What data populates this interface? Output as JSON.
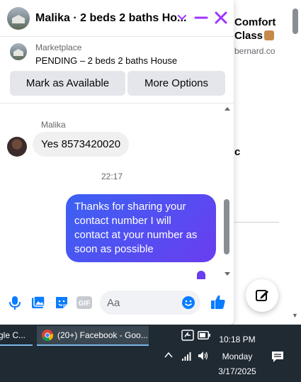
{
  "background_page": {
    "post_title_line1": "Comfort",
    "post_title_line2": "Class",
    "post_domain": "bernard.co",
    "partial_text": "c"
  },
  "chat": {
    "header": {
      "title": "Malika · 2 beds 2 baths Ho..."
    },
    "listing": {
      "source": "Marketplace",
      "status": "PENDING – 2 beds 2 baths House",
      "mark_available_label": "Mark as Available",
      "more_options_label": "More Options"
    },
    "messages": {
      "sender_name": "Malika",
      "incoming_text": "Yes 8573420020",
      "timestamp": "22:17",
      "outgoing_text": "Thanks for sharing your contact number I will contact at your number as soon as possible"
    },
    "composer": {
      "placeholder": "Aa",
      "gif_label": "GIF"
    }
  },
  "taskbar": {
    "prev_task_label": "gle C...",
    "chrome_task_label": "(20+) Facebook - Goo...",
    "clock_time": "10:18 PM",
    "clock_day": "Monday",
    "clock_date": "3/17/2025"
  },
  "colors": {
    "messenger_purple": "#a033ff",
    "messenger_blue": "#0a7cff",
    "bubble_gradient_start": "#3b62f3",
    "bubble_gradient_end": "#6a3df0",
    "taskbar": "#1f2a33"
  }
}
